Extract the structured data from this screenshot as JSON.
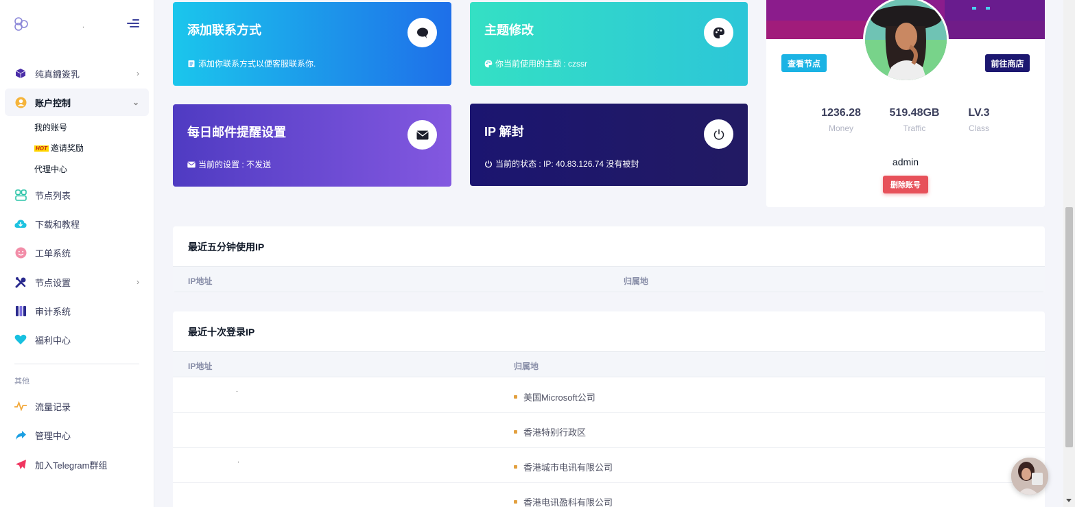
{
  "sidebar": {
    "brand_text": ".",
    "items": [
      {
        "label": "纯真鐤簽乳",
        "icon": "cube-icon",
        "has_arrow": true
      },
      {
        "label": "账户控制",
        "icon": "user-circle-icon",
        "has_arrow": true
      },
      {
        "label": "节点列表",
        "icon": "nodes-icon"
      },
      {
        "label": "下载和教程",
        "icon": "cloud-download-icon"
      },
      {
        "label": "工单系统",
        "icon": "smile-icon"
      },
      {
        "label": "节点设置",
        "icon": "tools-icon",
        "has_arrow": true
      },
      {
        "label": "审计系统",
        "icon": "audit-icon"
      },
      {
        "label": "福利中心",
        "icon": "heart-icon"
      }
    ],
    "subitems": [
      {
        "label": "我的账号"
      },
      {
        "label": "邀请奖励",
        "badge": "HOT"
      },
      {
        "label": "代理中心"
      }
    ],
    "section_label": "其他",
    "other_items": [
      {
        "label": "流量记录",
        "icon": "activity-icon"
      },
      {
        "label": "管理中心",
        "icon": "share-arrow-icon"
      },
      {
        "label": "加入Telegram群组",
        "icon": "telegram-icon"
      }
    ]
  },
  "cards": {
    "contact": {
      "title": "添加联系方式",
      "text": "添加你联系方式以便客服联系你."
    },
    "theme": {
      "title": "主题修改",
      "text": "你当前使用的主题 : czssr"
    },
    "email": {
      "title": "每日邮件提醒设置",
      "text": "当前的设置 : 不发送"
    },
    "ip": {
      "title": "IP 解封",
      "text": "当前的状态 : IP: 40.83.126.74 没有被封"
    }
  },
  "profile": {
    "btn_nodes": "查看节点",
    "btn_shop": "前往商店",
    "stats": [
      {
        "value": "1236.28",
        "label": "Money"
      },
      {
        "value": "519.48GB",
        "label": "Traffic"
      },
      {
        "value": "LV.3",
        "label": "Class"
      }
    ],
    "username": "admin",
    "delete_label": "删除账号"
  },
  "recent_ip": {
    "title": "最近五分钟使用IP",
    "headers": [
      "IP地址",
      "归属地"
    ]
  },
  "login_ip": {
    "title": "最近十次登录IP",
    "headers": [
      "IP地址",
      "归属地"
    ],
    "rows": [
      {
        "ip": ".",
        "loc": "美国Microsoft公司"
      },
      {
        "ip": "",
        "loc": "香港特别行政区"
      },
      {
        "ip": ".",
        "loc": "香港城市电讯有限公司"
      },
      {
        "ip": "",
        "loc": "香港电讯盈科有限公司"
      }
    ]
  },
  "colors": {
    "accent": "#1b55e2",
    "danger": "#e7515a",
    "navy": "#1c1770"
  }
}
